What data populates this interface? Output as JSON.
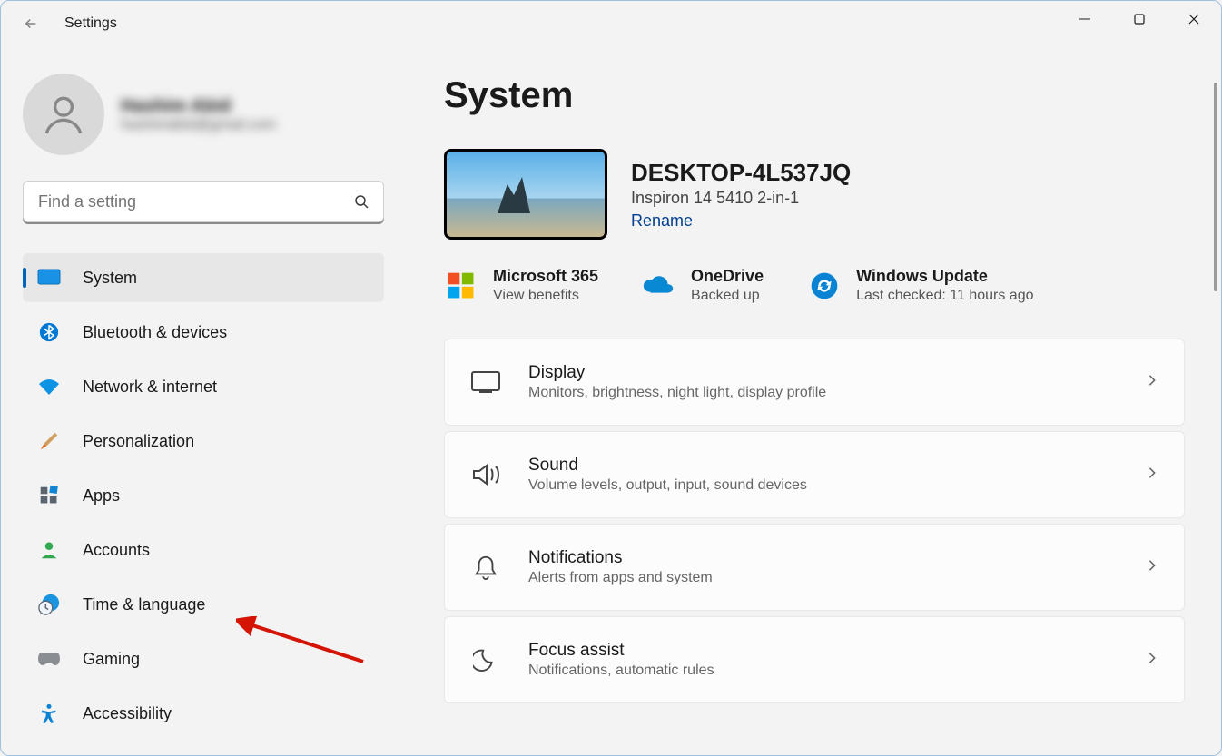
{
  "window": {
    "title": "Settings"
  },
  "profile": {
    "name": "Hashim Abid",
    "email": "hashimabid@gmail.com"
  },
  "search": {
    "placeholder": "Find a setting"
  },
  "nav": {
    "items": [
      {
        "label": "System"
      },
      {
        "label": "Bluetooth & devices"
      },
      {
        "label": "Network & internet"
      },
      {
        "label": "Personalization"
      },
      {
        "label": "Apps"
      },
      {
        "label": "Accounts"
      },
      {
        "label": "Time & language"
      },
      {
        "label": "Gaming"
      },
      {
        "label": "Accessibility"
      }
    ]
  },
  "page": {
    "title": "System"
  },
  "device": {
    "name": "DESKTOP-4L537JQ",
    "model": "Inspiron 14 5410 2-in-1",
    "rename": "Rename"
  },
  "status": {
    "m365": {
      "title": "Microsoft 365",
      "sub": "View benefits"
    },
    "onedrive": {
      "title": "OneDrive",
      "sub": "Backed up"
    },
    "update": {
      "title": "Windows Update",
      "sub": "Last checked: 11 hours ago"
    }
  },
  "cards": {
    "display": {
      "title": "Display",
      "sub": "Monitors, brightness, night light, display profile"
    },
    "sound": {
      "title": "Sound",
      "sub": "Volume levels, output, input, sound devices"
    },
    "notifications": {
      "title": "Notifications",
      "sub": "Alerts from apps and system"
    },
    "focus": {
      "title": "Focus assist",
      "sub": "Notifications, automatic rules"
    }
  }
}
